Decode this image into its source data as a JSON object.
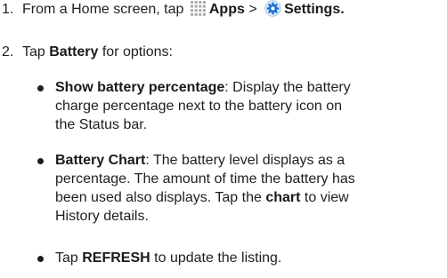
{
  "step1": {
    "number": "1.",
    "text_before": "From a Home screen, tap",
    "apps_icon": "apps-grid-icon",
    "apps_label": "Apps",
    "separator": ">",
    "settings_icon": "settings-gear-icon",
    "settings_label": "Settings",
    "period": "."
  },
  "step2": {
    "number": "2.",
    "text_before": "Tap",
    "battery_label": "Battery",
    "text_after": "for options:"
  },
  "bullet1": {
    "term": "Show battery percentage",
    "line1_rest": ": Display the battery",
    "line2": "charge percentage next to the battery icon on",
    "line3": "the Status bar."
  },
  "bullet2": {
    "term": "Battery Chart",
    "line1_rest": ": The battery level displays as a",
    "line2": "percentage. The amount of time the battery has",
    "line3_before": "been used also displays. Tap the",
    "line3_bold": "chart",
    "line3_after": "to view",
    "line4": "History details."
  },
  "bullet3": {
    "text_before": "Tap",
    "bold": "REFRESH",
    "text_after": "to update the listing."
  },
  "colors": {
    "text": "#1f1f1f",
    "gear_blue": "#1e6fd0",
    "apps_gray": "#a8a8a8"
  }
}
